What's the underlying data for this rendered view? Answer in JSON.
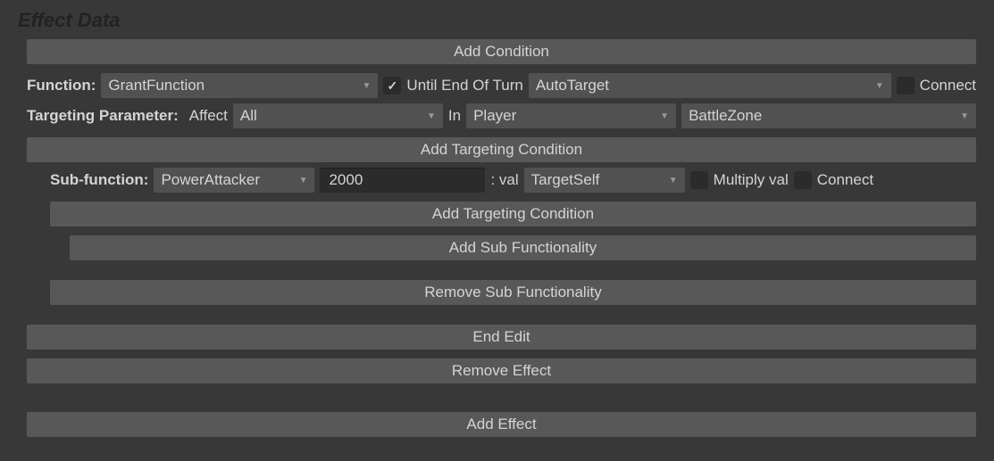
{
  "title": "Effect Data",
  "buttons": {
    "add_condition": "Add Condition",
    "add_targeting_condition": "Add Targeting Condition",
    "add_targeting_condition_2": "Add Targeting Condition",
    "add_sub_functionality": "Add Sub Functionality",
    "remove_sub_functionality": "Remove Sub Functionality",
    "end_edit": "End Edit",
    "remove_effect": "Remove Effect",
    "add_effect": "Add Effect"
  },
  "function_row": {
    "label": "Function:",
    "function_value": "GrantFunction",
    "until_end_checked": true,
    "until_end_label": "Until End Of Turn",
    "target_mode": "AutoTarget",
    "connect_label": "Connect",
    "connect_checked": false
  },
  "targeting_row": {
    "label": "Targeting Parameter:",
    "affect_label": "Affect",
    "affect_value": "All",
    "in_label": "In",
    "in_value": "Player",
    "zone_value": "BattleZone"
  },
  "subfunction_row": {
    "label": "Sub-function:",
    "sub_value": "PowerAttacker",
    "amount": "2000",
    "val_suffix": ": val",
    "target_value": "TargetSelf",
    "multiply_label": "Multiply val",
    "multiply_checked": false,
    "connect_label": "Connect",
    "connect_checked": false
  }
}
